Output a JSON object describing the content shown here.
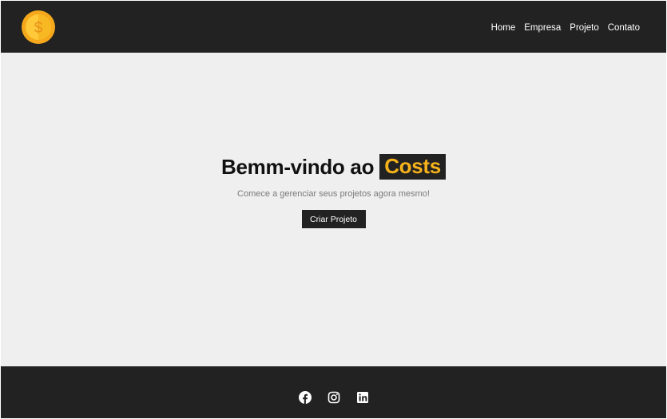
{
  "header": {
    "logo_icon": "dollar-coin-icon",
    "nav": [
      {
        "label": "Home"
      },
      {
        "label": "Empresa"
      },
      {
        "label": "Projeto"
      },
      {
        "label": "Contato"
      }
    ]
  },
  "hero": {
    "title_prefix": "Bemm-vindo ao",
    "title_brand": "Costs",
    "subtitle": "Comece a gerenciar seus projetos agora mesmo!",
    "cta_label": "Criar Projeto"
  },
  "footer": {
    "social": [
      {
        "icon": "facebook-icon"
      },
      {
        "icon": "instagram-icon"
      },
      {
        "icon": "linkedin-icon"
      }
    ]
  },
  "colors": {
    "dark": "#222222",
    "accent": "#f6b21b",
    "background": "#efefef"
  }
}
